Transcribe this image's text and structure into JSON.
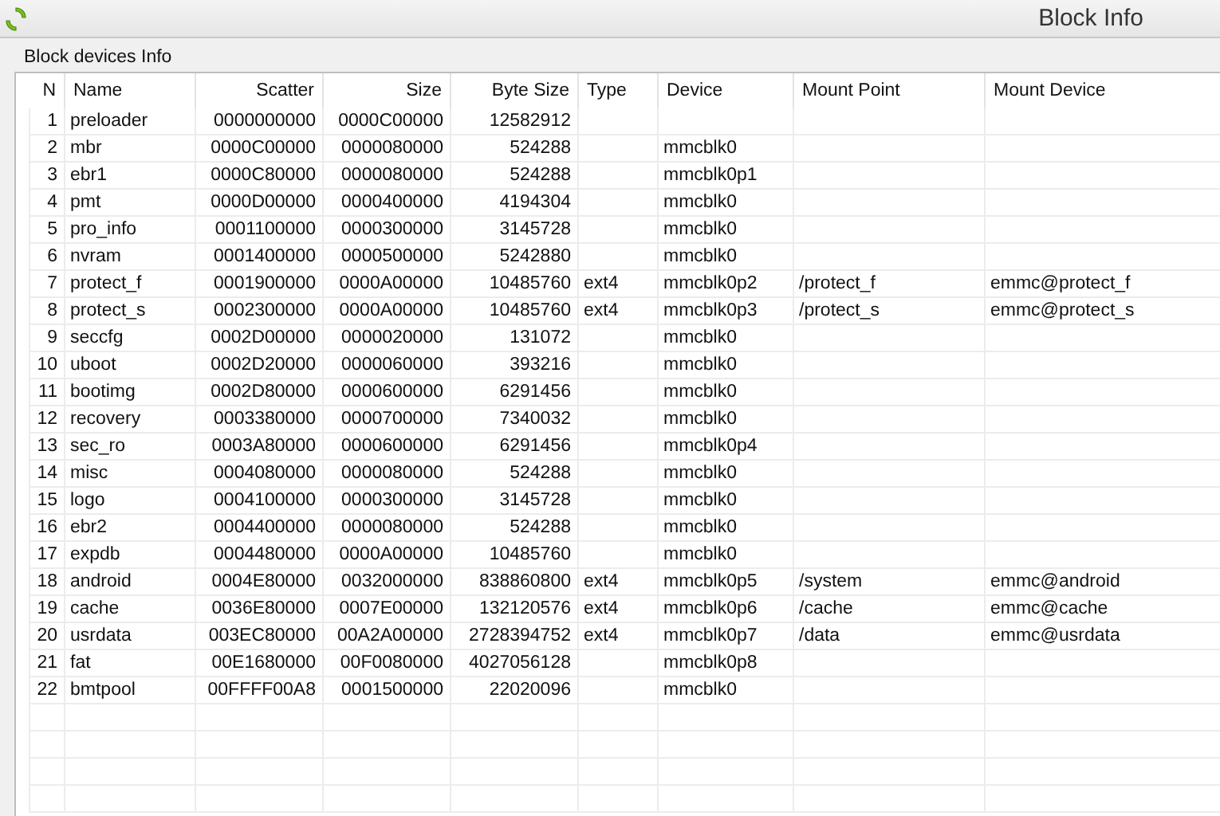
{
  "window": {
    "title": "Block Info"
  },
  "group": {
    "title": "Block devices Info"
  },
  "table": {
    "columns": [
      "N",
      "Name",
      "Scatter",
      "Size",
      "Byte Size",
      "Type",
      "Device",
      "Mount Point",
      "Mount Device"
    ],
    "rows": [
      [
        "1",
        "preloader",
        "0000000000",
        "0000C00000",
        "12582912",
        "",
        "",
        "",
        ""
      ],
      [
        "2",
        "mbr",
        "0000C00000",
        "0000080000",
        "524288",
        "",
        "mmcblk0",
        "",
        ""
      ],
      [
        "3",
        "ebr1",
        "0000C80000",
        "0000080000",
        "524288",
        "",
        "mmcblk0p1",
        "",
        ""
      ],
      [
        "4",
        "pmt",
        "0000D00000",
        "0000400000",
        "4194304",
        "",
        "mmcblk0",
        "",
        ""
      ],
      [
        "5",
        "pro_info",
        "0001100000",
        "0000300000",
        "3145728",
        "",
        "mmcblk0",
        "",
        ""
      ],
      [
        "6",
        "nvram",
        "0001400000",
        "0000500000",
        "5242880",
        "",
        "mmcblk0",
        "",
        ""
      ],
      [
        "7",
        "protect_f",
        "0001900000",
        "0000A00000",
        "10485760",
        "ext4",
        "mmcblk0p2",
        "/protect_f",
        "emmc@protect_f"
      ],
      [
        "8",
        "protect_s",
        "0002300000",
        "0000A00000",
        "10485760",
        "ext4",
        "mmcblk0p3",
        "/protect_s",
        "emmc@protect_s"
      ],
      [
        "9",
        "seccfg",
        "0002D00000",
        "0000020000",
        "131072",
        "",
        "mmcblk0",
        "",
        ""
      ],
      [
        "10",
        "uboot",
        "0002D20000",
        "0000060000",
        "393216",
        "",
        "mmcblk0",
        "",
        ""
      ],
      [
        "11",
        "bootimg",
        "0002D80000",
        "0000600000",
        "6291456",
        "",
        "mmcblk0",
        "",
        ""
      ],
      [
        "12",
        "recovery",
        "0003380000",
        "0000700000",
        "7340032",
        "",
        "mmcblk0",
        "",
        ""
      ],
      [
        "13",
        "sec_ro",
        "0003A80000",
        "0000600000",
        "6291456",
        "",
        "mmcblk0p4",
        "",
        ""
      ],
      [
        "14",
        "misc",
        "0004080000",
        "0000080000",
        "524288",
        "",
        "mmcblk0",
        "",
        ""
      ],
      [
        "15",
        "logo",
        "0004100000",
        "0000300000",
        "3145728",
        "",
        "mmcblk0",
        "",
        ""
      ],
      [
        "16",
        "ebr2",
        "0004400000",
        "0000080000",
        "524288",
        "",
        "mmcblk0",
        "",
        ""
      ],
      [
        "17",
        "expdb",
        "0004480000",
        "0000A00000",
        "10485760",
        "",
        "mmcblk0",
        "",
        ""
      ],
      [
        "18",
        "android",
        "0004E80000",
        "0032000000",
        "838860800",
        "ext4",
        "mmcblk0p5",
        "/system",
        "emmc@android"
      ],
      [
        "19",
        "cache",
        "0036E80000",
        "0007E00000",
        "132120576",
        "ext4",
        "mmcblk0p6",
        "/cache",
        "emmc@cache"
      ],
      [
        "20",
        "usrdata",
        "003EC80000",
        "00A2A00000",
        "2728394752",
        "ext4",
        "mmcblk0p7",
        "/data",
        "emmc@usrdata"
      ],
      [
        "21",
        "fat",
        "00E1680000",
        "00F0080000",
        "4027056128",
        "",
        "mmcblk0p8",
        "",
        ""
      ],
      [
        "22",
        "bmtpool",
        "00FFFF00A8",
        "0001500000",
        "22020096",
        "",
        "mmcblk0",
        "",
        ""
      ]
    ]
  }
}
